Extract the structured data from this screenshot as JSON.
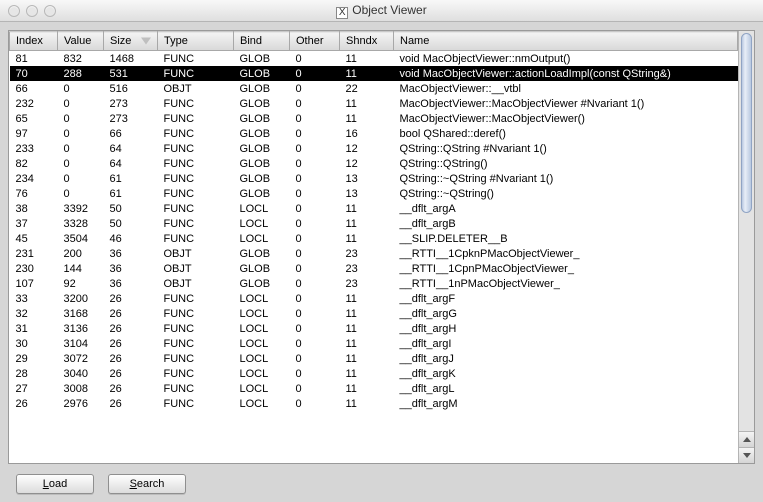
{
  "window": {
    "title": "Object Viewer"
  },
  "columns": [
    {
      "key": "index",
      "label": "Index"
    },
    {
      "key": "value",
      "label": "Value"
    },
    {
      "key": "size",
      "label": "Size",
      "sort": true
    },
    {
      "key": "type",
      "label": "Type"
    },
    {
      "key": "bind",
      "label": "Bind"
    },
    {
      "key": "other",
      "label": "Other"
    },
    {
      "key": "shndx",
      "label": "Shndx"
    },
    {
      "key": "name",
      "label": "Name"
    }
  ],
  "rows": [
    {
      "index": "81",
      "value": "832",
      "size": "1468",
      "type": "FUNC",
      "bind": "GLOB",
      "other": "0",
      "shndx": "11",
      "name": "void MacObjectViewer::nmOutput()"
    },
    {
      "index": "70",
      "value": "288",
      "size": "531",
      "type": "FUNC",
      "bind": "GLOB",
      "other": "0",
      "shndx": "11",
      "name": "void MacObjectViewer::actionLoadImpl(const QString&)",
      "selected": true
    },
    {
      "index": "66",
      "value": "0",
      "size": "516",
      "type": "OBJT",
      "bind": "GLOB",
      "other": "0",
      "shndx": "22",
      "name": "MacObjectViewer::__vtbl"
    },
    {
      "index": "232",
      "value": "0",
      "size": "273",
      "type": "FUNC",
      "bind": "GLOB",
      "other": "0",
      "shndx": "11",
      "name": "MacObjectViewer::MacObjectViewer #Nvariant 1()"
    },
    {
      "index": "65",
      "value": "0",
      "size": "273",
      "type": "FUNC",
      "bind": "GLOB",
      "other": "0",
      "shndx": "11",
      "name": "MacObjectViewer::MacObjectViewer()"
    },
    {
      "index": "97",
      "value": "0",
      "size": "66",
      "type": "FUNC",
      "bind": "GLOB",
      "other": "0",
      "shndx": "16",
      "name": "bool QShared::deref()"
    },
    {
      "index": "233",
      "value": "0",
      "size": "64",
      "type": "FUNC",
      "bind": "GLOB",
      "other": "0",
      "shndx": "12",
      "name": "QString::QString #Nvariant 1()"
    },
    {
      "index": "82",
      "value": "0",
      "size": "64",
      "type": "FUNC",
      "bind": "GLOB",
      "other": "0",
      "shndx": "12",
      "name": "QString::QString()"
    },
    {
      "index": "234",
      "value": "0",
      "size": "61",
      "type": "FUNC",
      "bind": "GLOB",
      "other": "0",
      "shndx": "13",
      "name": "QString::~QString #Nvariant 1()"
    },
    {
      "index": "76",
      "value": "0",
      "size": "61",
      "type": "FUNC",
      "bind": "GLOB",
      "other": "0",
      "shndx": "13",
      "name": "QString::~QString()"
    },
    {
      "index": "38",
      "value": "3392",
      "size": "50",
      "type": "FUNC",
      "bind": "LOCL",
      "other": "0",
      "shndx": "11",
      "name": "__dflt_argA"
    },
    {
      "index": "37",
      "value": "3328",
      "size": "50",
      "type": "FUNC",
      "bind": "LOCL",
      "other": "0",
      "shndx": "11",
      "name": "__dflt_argB"
    },
    {
      "index": "45",
      "value": "3504",
      "size": "46",
      "type": "FUNC",
      "bind": "LOCL",
      "other": "0",
      "shndx": "11",
      "name": "__SLIP.DELETER__B"
    },
    {
      "index": "231",
      "value": "200",
      "size": "36",
      "type": "OBJT",
      "bind": "GLOB",
      "other": "0",
      "shndx": "23",
      "name": "__RTTI__1CpknPMacObjectViewer_"
    },
    {
      "index": "230",
      "value": "144",
      "size": "36",
      "type": "OBJT",
      "bind": "GLOB",
      "other": "0",
      "shndx": "23",
      "name": "__RTTI__1CpnPMacObjectViewer_"
    },
    {
      "index": "107",
      "value": "92",
      "size": "36",
      "type": "OBJT",
      "bind": "GLOB",
      "other": "0",
      "shndx": "23",
      "name": "__RTTI__1nPMacObjectViewer_"
    },
    {
      "index": "33",
      "value": "3200",
      "size": "26",
      "type": "FUNC",
      "bind": "LOCL",
      "other": "0",
      "shndx": "11",
      "name": "__dflt_argF"
    },
    {
      "index": "32",
      "value": "3168",
      "size": "26",
      "type": "FUNC",
      "bind": "LOCL",
      "other": "0",
      "shndx": "11",
      "name": "__dflt_argG"
    },
    {
      "index": "31",
      "value": "3136",
      "size": "26",
      "type": "FUNC",
      "bind": "LOCL",
      "other": "0",
      "shndx": "11",
      "name": "__dflt_argH"
    },
    {
      "index": "30",
      "value": "3104",
      "size": "26",
      "type": "FUNC",
      "bind": "LOCL",
      "other": "0",
      "shndx": "11",
      "name": "__dflt_argI"
    },
    {
      "index": "29",
      "value": "3072",
      "size": "26",
      "type": "FUNC",
      "bind": "LOCL",
      "other": "0",
      "shndx": "11",
      "name": "__dflt_argJ"
    },
    {
      "index": "28",
      "value": "3040",
      "size": "26",
      "type": "FUNC",
      "bind": "LOCL",
      "other": "0",
      "shndx": "11",
      "name": "__dflt_argK"
    },
    {
      "index": "27",
      "value": "3008",
      "size": "26",
      "type": "FUNC",
      "bind": "LOCL",
      "other": "0",
      "shndx": "11",
      "name": "__dflt_argL"
    },
    {
      "index": "26",
      "value": "2976",
      "size": "26",
      "type": "FUNC",
      "bind": "LOCL",
      "other": "0",
      "shndx": "11",
      "name": "__dflt_argM"
    }
  ],
  "buttons": {
    "load": {
      "prefix": "L",
      "rest": "oad"
    },
    "search": {
      "prefix": "S",
      "rest": "earch"
    }
  }
}
